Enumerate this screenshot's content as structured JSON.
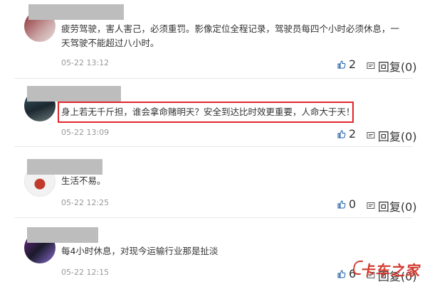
{
  "comments": [
    {
      "text_lines": [
        "疲劳驾驶，害人害己，必须重罚。影像定位全程记录，驾驶员每四个小时必须休息，一",
        "天驾驶不能超过八小时。"
      ],
      "time": "05-22 13:12",
      "likes": "2",
      "reply_label": "回复(0)"
    },
    {
      "text_lines": [
        "身上若无千斤担，谁会拿命赌明天？安全到达比时效更重要，人命大于天！"
      ],
      "time": "05-22 13:09",
      "likes": "2",
      "reply_label": "回复(0)"
    },
    {
      "text_lines": [
        "生活不易。"
      ],
      "time": "05-22 12:25",
      "likes": "0",
      "reply_label": "回复(0)"
    },
    {
      "text_lines": [
        "每4小时休息，对现今运输行业那是扯淡"
      ],
      "time": "05-22 12:15",
      "likes": "6",
      "reply_label": "回复(0)"
    }
  ],
  "watermark": "卡车之家",
  "colors": {
    "highlight_border": "#e0262b",
    "watermark": "#d23a2f",
    "redaction": "#bdbdbd"
  },
  "icons": [
    "thumbs-up-icon",
    "reply-icon"
  ]
}
